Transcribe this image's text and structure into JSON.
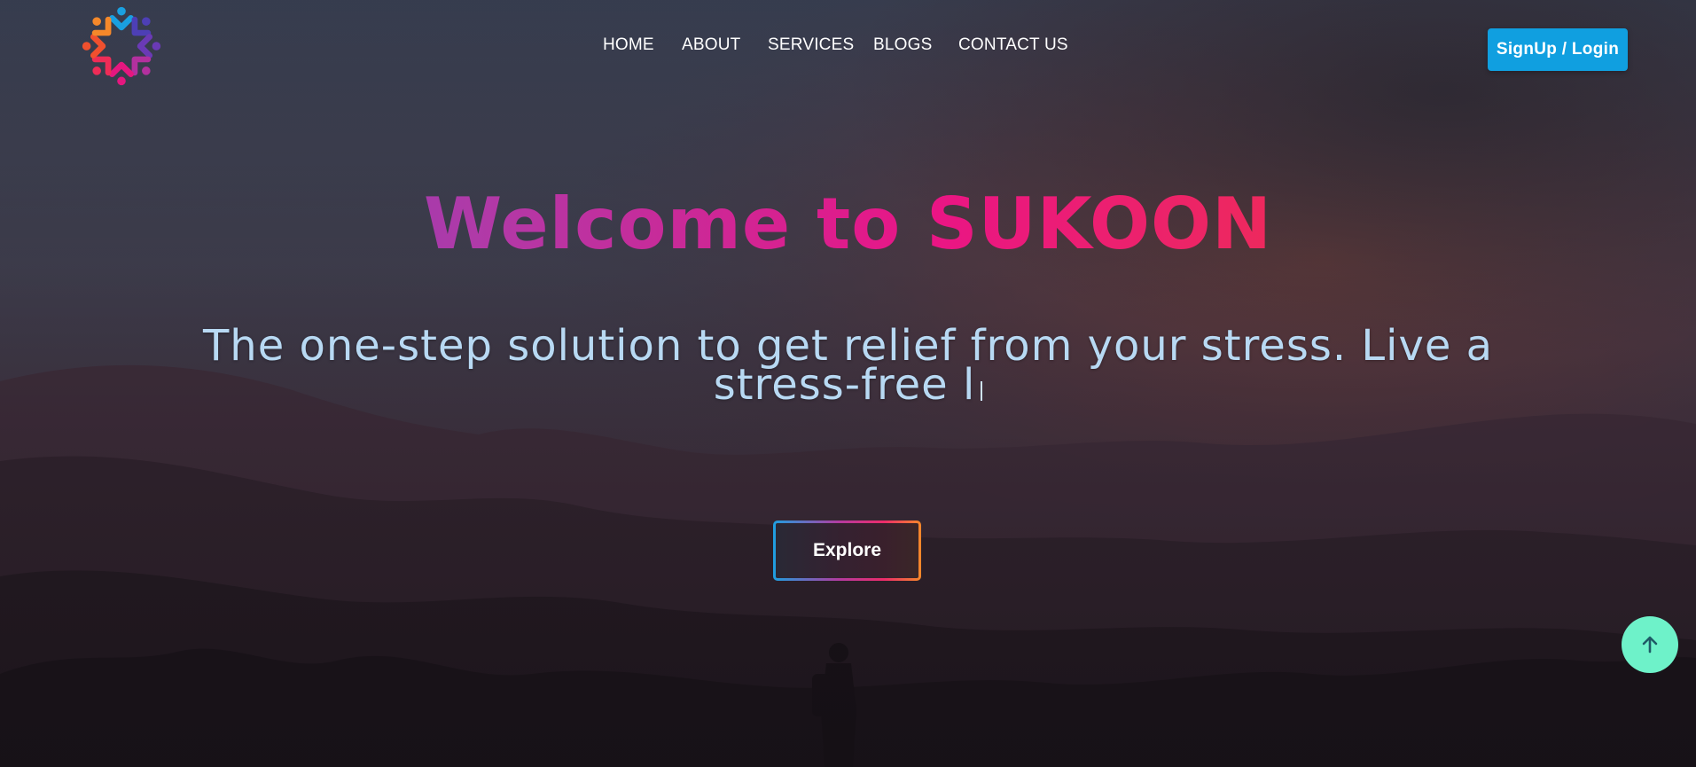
{
  "brand": {
    "logo_icon": "people-circle-logo-icon"
  },
  "nav": {
    "items": [
      {
        "label": "HOME"
      },
      {
        "label": "ABOUT"
      },
      {
        "label": "SERVICES"
      },
      {
        "label": "BLOGS"
      },
      {
        "label": "CONTACT US"
      }
    ],
    "signup_label": "SignUp / Login",
    "signup_color": "#109fe0"
  },
  "hero": {
    "title": "Welcome to SUKOON",
    "tagline": "The one-step solution to get relief from your stress. Live a stress-free l",
    "explore_label": "Explore",
    "background": "mountain-sunset-silhouette"
  },
  "scroll_top": {
    "icon": "arrow-up-icon",
    "color": "#6ef2c9"
  }
}
